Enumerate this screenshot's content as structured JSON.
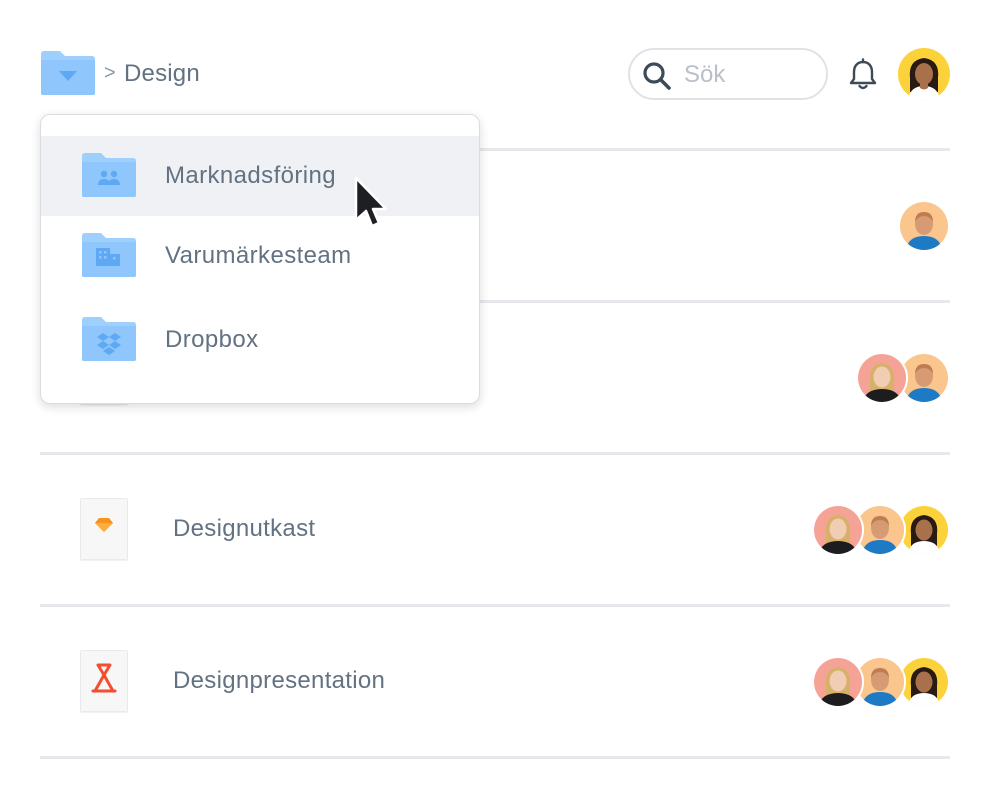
{
  "header": {
    "separator": ">",
    "title": "Design",
    "search": {
      "placeholder": "Sök",
      "value": ""
    }
  },
  "dropdown": {
    "items": [
      {
        "label": "Marknadsföring",
        "icon": "team-folder-icon"
      },
      {
        "label": "Varumärkesteam",
        "icon": "company-folder-icon"
      },
      {
        "label": "Dropbox",
        "icon": "dropbox-folder-icon"
      }
    ]
  },
  "files": [
    {
      "label": "",
      "collaborators": 1
    },
    {
      "label": "",
      "collaborators": 2
    },
    {
      "label": "Designutkast",
      "icon": "sketch-file-icon",
      "collaborators": 3
    },
    {
      "label": "Designpresentation",
      "icon": "acrobat-file-icon",
      "collaborators": 3
    }
  ],
  "colors": {
    "folder": "#8fc6fb",
    "folder_dark": "#5fa8f4",
    "text": "#637282",
    "divider": "#e6e8eb",
    "sketch": "#f7931e",
    "acrobat": "#f24f2e"
  }
}
